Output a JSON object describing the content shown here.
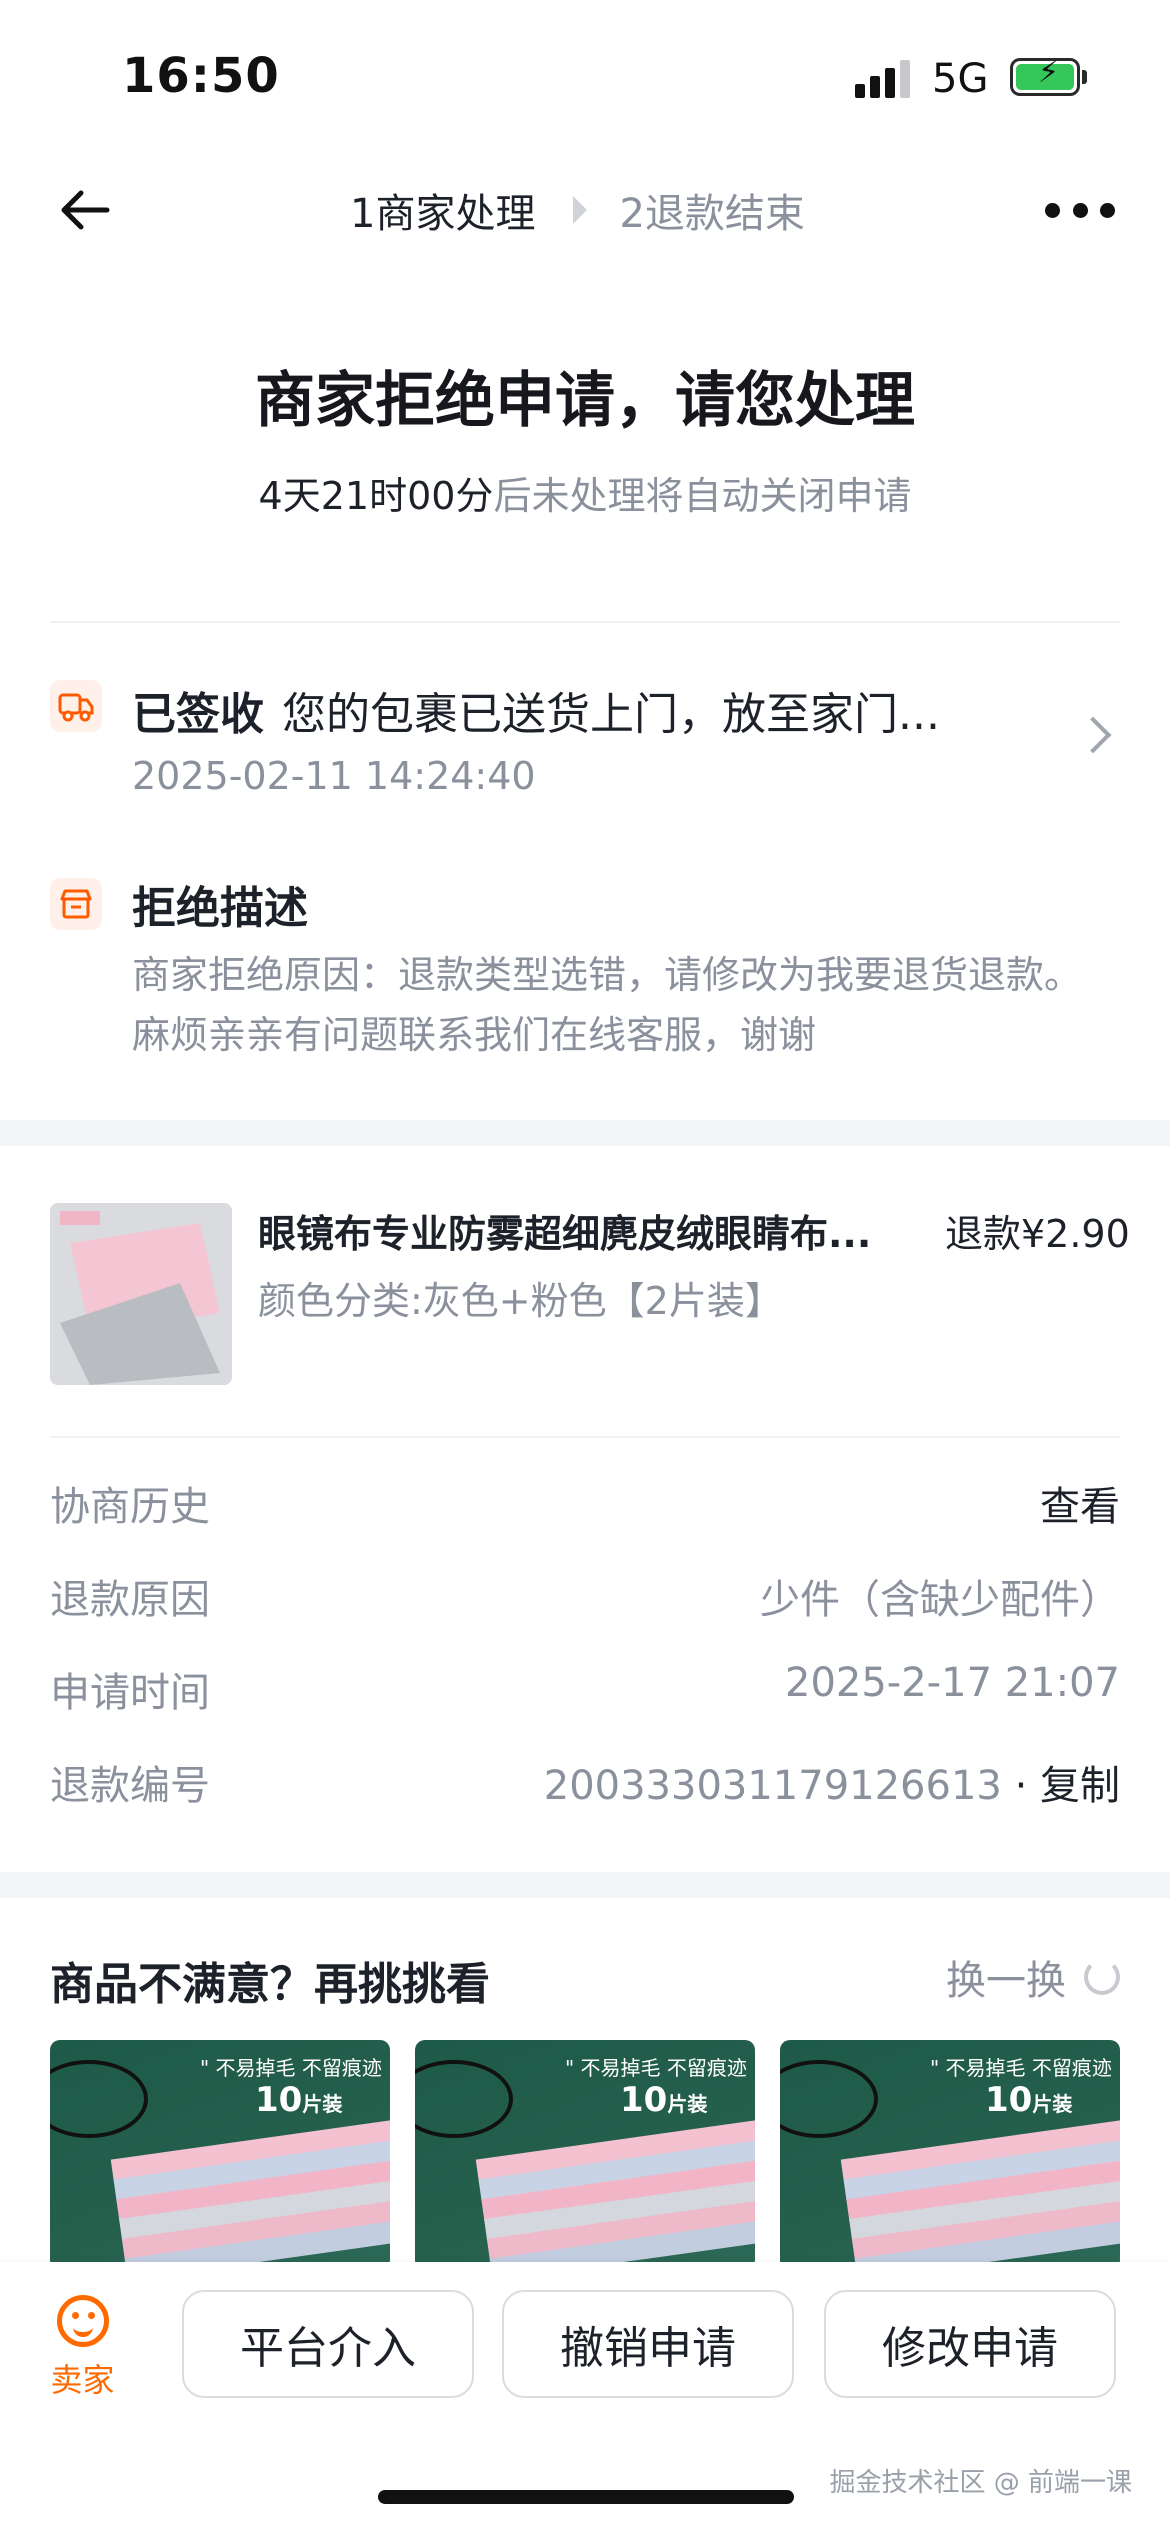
{
  "status_bar": {
    "time": "16:50",
    "network": "5G"
  },
  "nav": {
    "step1": "1商家处理",
    "step2": "2退款结束"
  },
  "header": {
    "title": "商家拒绝申请，请您处理",
    "countdown": "4天21时00分",
    "countdown_suffix": "后未处理将自动关闭申请"
  },
  "logistics": {
    "status": "已签收",
    "detail": "您的包裹已送货上门，放至家门...",
    "time": "2025-02-11 14:24:40"
  },
  "refusal": {
    "title": "拒绝描述",
    "text": "商家拒绝原因：退款类型选错，请修改为我要退货退款。麻烦亲亲有问题联系我们在线客服，谢谢"
  },
  "product": {
    "name": "眼镜布专业防雾超细麂皮绒眼睛布...",
    "refund": "退款¥2.90",
    "spec": "颜色分类:灰色+粉色【2片装】"
  },
  "info": {
    "history_label": "协商历史",
    "history_value": "查看",
    "reason_label": "退款原因",
    "reason_value": "少件（含缺少配件）",
    "time_label": "申请时间",
    "time_value": "2025-2-17 21:07",
    "number_label": "退款编号",
    "number_value": "200333031179126613",
    "copy": "· 复制"
  },
  "recommend": {
    "title": "商品不满意？再挑挑看",
    "refresh": "换一换",
    "card_tag": "\" 不易掉毛  不留痕迹",
    "card_count": "10",
    "card_unit": "片装"
  },
  "bottom": {
    "seller": "卖家",
    "btn1": "平台介入",
    "btn2": "撤销申请",
    "btn3": "修改申请"
  },
  "watermark": "掘金技术社区 @ 前端一课",
  "colors": {
    "accent": "#ff6a00",
    "text": "#1d2129",
    "muted": "#8a909c"
  }
}
